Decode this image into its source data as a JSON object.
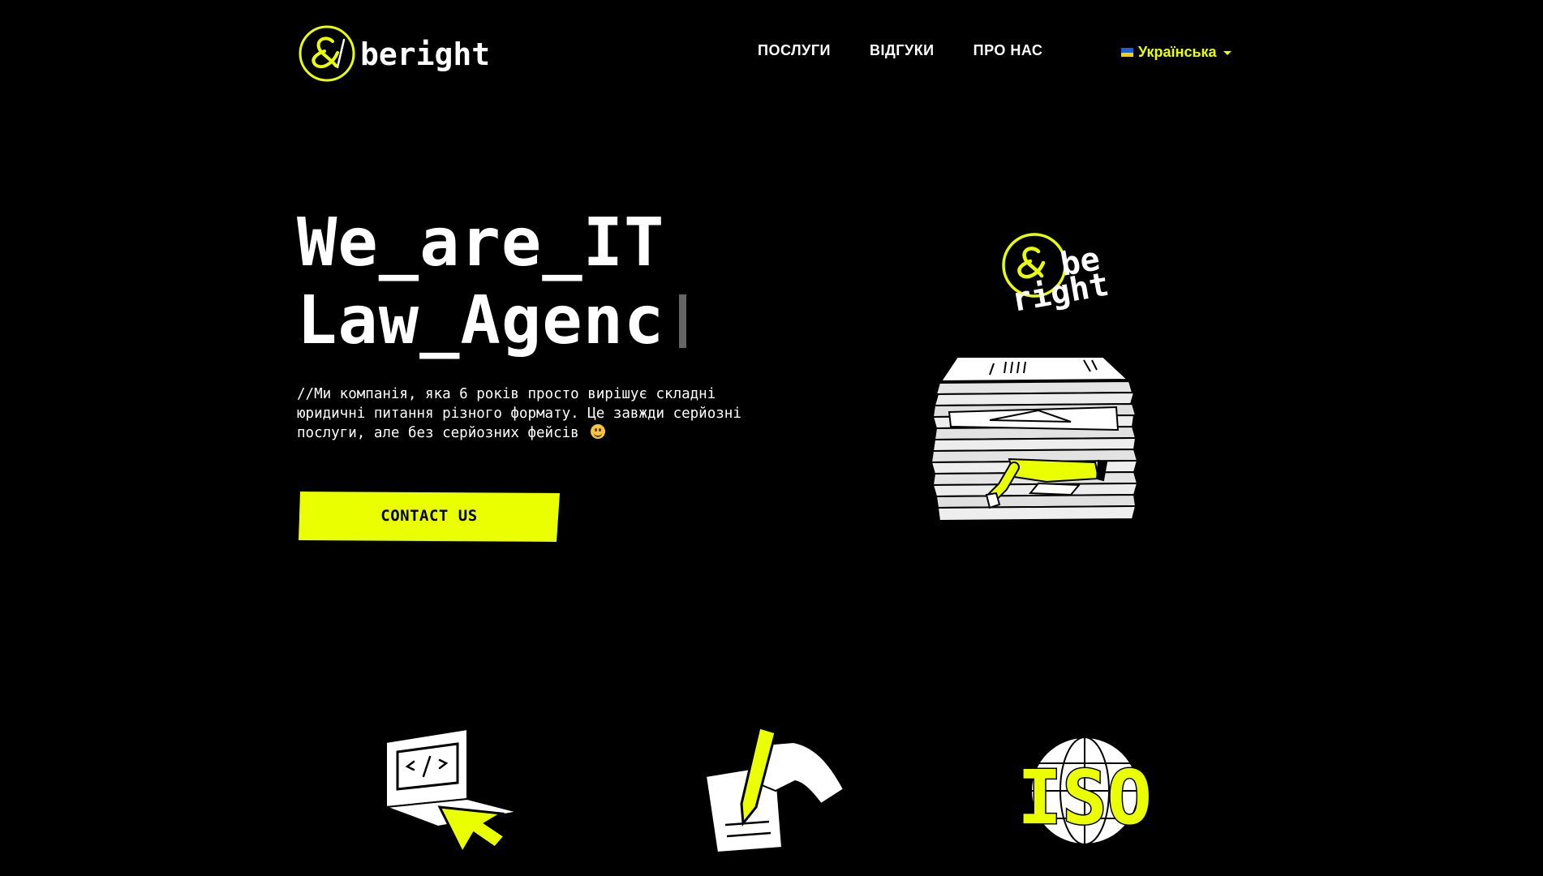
{
  "brand": {
    "name": "beright",
    "accent_color": "#eaff00",
    "background_color": "#000000"
  },
  "nav": {
    "items": [
      {
        "label": "ПОСЛУГИ"
      },
      {
        "label": "ВІДГУКИ"
      },
      {
        "label": "ПРО НАС"
      }
    ]
  },
  "language": {
    "selected": "Українська",
    "flag_icon": "ukraine-flag-icon"
  },
  "hero": {
    "title_line1": "We_are_IT",
    "title_line2": "Law_Agenc",
    "description": "//Ми компанія, яка 6 років просто вирішує складні юридичні питання різного формату. Це завжди серйозні послуги, але без серйозних фейсів",
    "emoji_icon": "smiley-icon",
    "cta_label": "CONTACT US"
  },
  "illustration": {
    "logo_top": "be",
    "logo_bottom": "right",
    "scene": "person-under-paper-stack-illustration"
  },
  "features": [
    {
      "icon": "laptop-code-cursor-icon"
    },
    {
      "icon": "hand-pen-document-icon"
    },
    {
      "icon_text": "ISO",
      "icon": "iso-globe-icon"
    }
  ]
}
